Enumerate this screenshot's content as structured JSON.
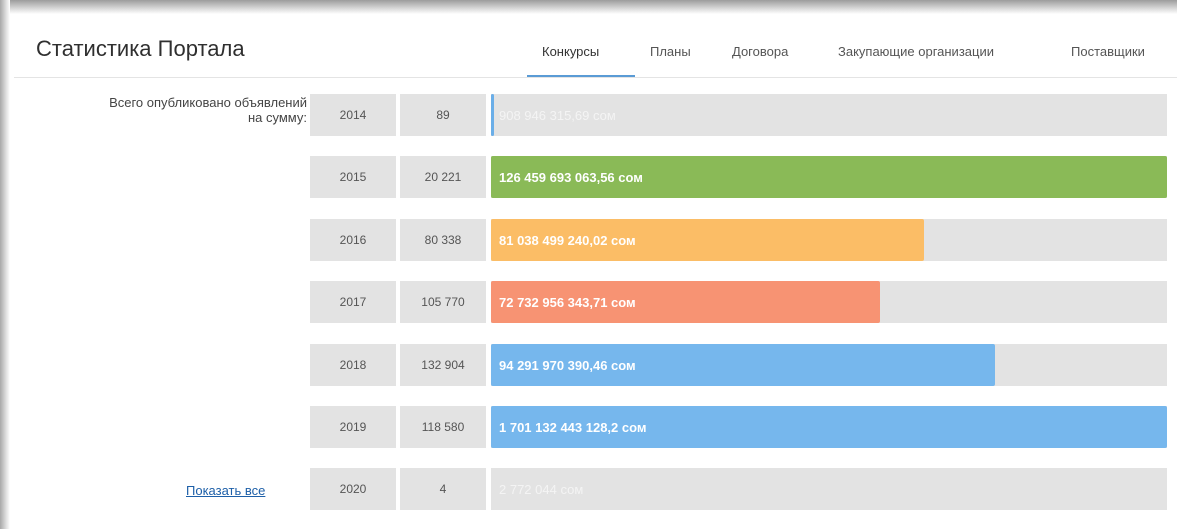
{
  "header": {
    "title": "Статистика Портала",
    "tabs": [
      {
        "label": "Конкурсы",
        "active": true
      },
      {
        "label": "Планы",
        "active": false
      },
      {
        "label": "Договора",
        "active": false
      },
      {
        "label": "Закупающие организации",
        "active": false
      },
      {
        "label": "Поставщики",
        "active": false
      }
    ]
  },
  "stats": {
    "label_line1": "Всего опубликовано объявлений",
    "label_line2": "на сумму:",
    "show_all": "Показать все",
    "rows": [
      {
        "year": "2014",
        "count": "89",
        "amount": "908 946 315,69 сом",
        "fill_pct": 0.5,
        "color": "#6aaee8"
      },
      {
        "year": "2015",
        "count": "20 221",
        "amount": "126 459 693 063,56 сом",
        "fill_pct": 100,
        "color": "#8aba57"
      },
      {
        "year": "2016",
        "count": "80 338",
        "amount": "81 038 499 240,02 сом",
        "fill_pct": 64,
        "color": "#fbbd66"
      },
      {
        "year": "2017",
        "count": "105 770",
        "amount": "72 732 956 343,71 сом",
        "fill_pct": 57.5,
        "color": "#f79373"
      },
      {
        "year": "2018",
        "count": "132 904",
        "amount": "94 291 970 390,46 сом",
        "fill_pct": 74.5,
        "color": "#76b7ed"
      },
      {
        "year": "2019",
        "count": "118 580",
        "amount": "1 701 132 443 128,2 сом",
        "fill_pct": 100,
        "color": "#76b7ed"
      },
      {
        "year": "2020",
        "count": "4",
        "amount": "2 772 044 сом",
        "fill_pct": 0,
        "color": "#76b7ed"
      }
    ]
  }
}
